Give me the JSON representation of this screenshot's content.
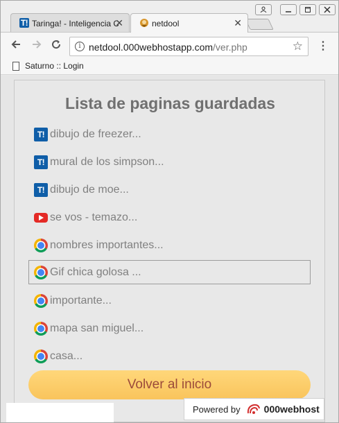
{
  "browser": {
    "tabs": [
      {
        "title": "Taringa! - Inteligencia Colectiva",
        "favicon": "taringa-icon"
      },
      {
        "title": "netdool",
        "favicon": "netdool-icon"
      }
    ],
    "tab_close": "✕",
    "address": {
      "domain": "netdool.000webhostapp.com",
      "path": "/ver.php"
    },
    "bookmarks": [
      {
        "label": "Saturno :: Login"
      }
    ]
  },
  "page": {
    "title": "Lista de paginas guardadas",
    "items": [
      {
        "label": "dibujo de freezer...",
        "icon": "taringa-icon",
        "icon_text": "T!"
      },
      {
        "label": "mural de los simpson...",
        "icon": "taringa-icon",
        "icon_text": "T!"
      },
      {
        "label": "dibujo de moe...",
        "icon": "taringa-icon",
        "icon_text": "T!"
      },
      {
        "label": "se vos - temazo...",
        "icon": "youtube-icon",
        "icon_text": ""
      },
      {
        "label": "nombres importantes...",
        "icon": "chrome-icon",
        "icon_text": ""
      },
      {
        "label": "Gif chica golosa ...",
        "icon": "chrome-icon",
        "icon_text": ""
      },
      {
        "label": "importante...",
        "icon": "chrome-icon",
        "icon_text": ""
      },
      {
        "label": "mapa san miguel...",
        "icon": "chrome-icon",
        "icon_text": ""
      },
      {
        "label": "casa...",
        "icon": "chrome-icon",
        "icon_text": ""
      }
    ],
    "home_button": "Volver al inicio"
  },
  "powered_by": {
    "label": "Powered by",
    "brand": "000webhost"
  },
  "colors": {
    "accent_button": "#f9c45c",
    "button_text": "#9b4a3a",
    "taringa_blue": "#0f5ea8"
  }
}
